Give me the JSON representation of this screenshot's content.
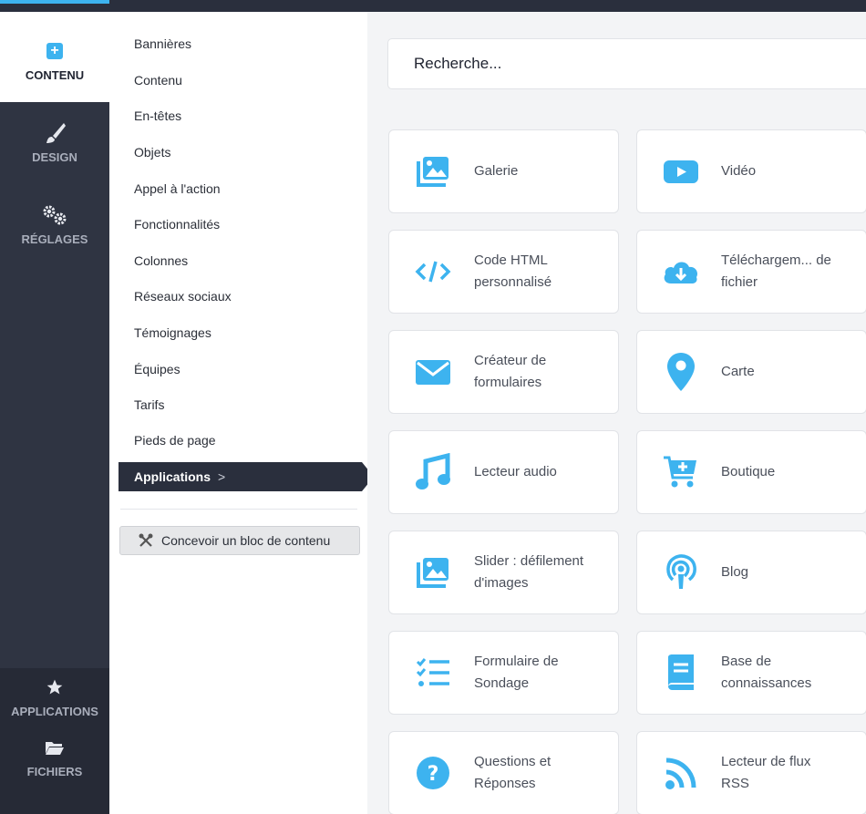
{
  "rail": {
    "items": [
      {
        "label": "CONTENU"
      },
      {
        "label": "DESIGN"
      },
      {
        "label": "RÉGLAGES"
      },
      {
        "label": "APPLICATIONS"
      },
      {
        "label": "FICHIERS"
      }
    ]
  },
  "categories": [
    "Bannières",
    "Contenu",
    "En-têtes",
    "Objets",
    "Appel à l'action",
    "Fonctionnalités",
    "Colonnes",
    "Réseaux sociaux",
    "Témoignages",
    "Équipes",
    "Tarifs",
    "Pieds de page"
  ],
  "active_category": "Applications",
  "design_button": "Concevoir un bloc de contenu",
  "search": {
    "placeholder": "Recherche..."
  },
  "apps": [
    {
      "label": "Galerie",
      "icon": "gallery-icon"
    },
    {
      "label": "Vidéo",
      "icon": "video-icon"
    },
    {
      "label": "Code HTML personnalisé",
      "icon": "code-icon"
    },
    {
      "label": "Téléchargem... de fichier",
      "icon": "cloud-download-icon"
    },
    {
      "label": "Créateur de formulaires",
      "icon": "envelope-icon"
    },
    {
      "label": "Carte",
      "icon": "map-pin-icon"
    },
    {
      "label": "Lecteur audio",
      "icon": "music-icon"
    },
    {
      "label": "Boutique",
      "icon": "cart-icon"
    },
    {
      "label": "Slider : défilement d'images",
      "icon": "slider-icon"
    },
    {
      "label": "Blog",
      "icon": "podcast-icon"
    },
    {
      "label": "Formulaire de Sondage",
      "icon": "checklist-icon"
    },
    {
      "label": "Base de connaissances",
      "icon": "book-icon"
    },
    {
      "label": "Questions et Réponses",
      "icon": "question-icon"
    },
    {
      "label": "Lecteur de flux RSS",
      "icon": "rss-icon"
    }
  ],
  "colors": {
    "accent": "#3db3ef",
    "dark": "#2a2f3d",
    "rail": "#2f3442"
  }
}
